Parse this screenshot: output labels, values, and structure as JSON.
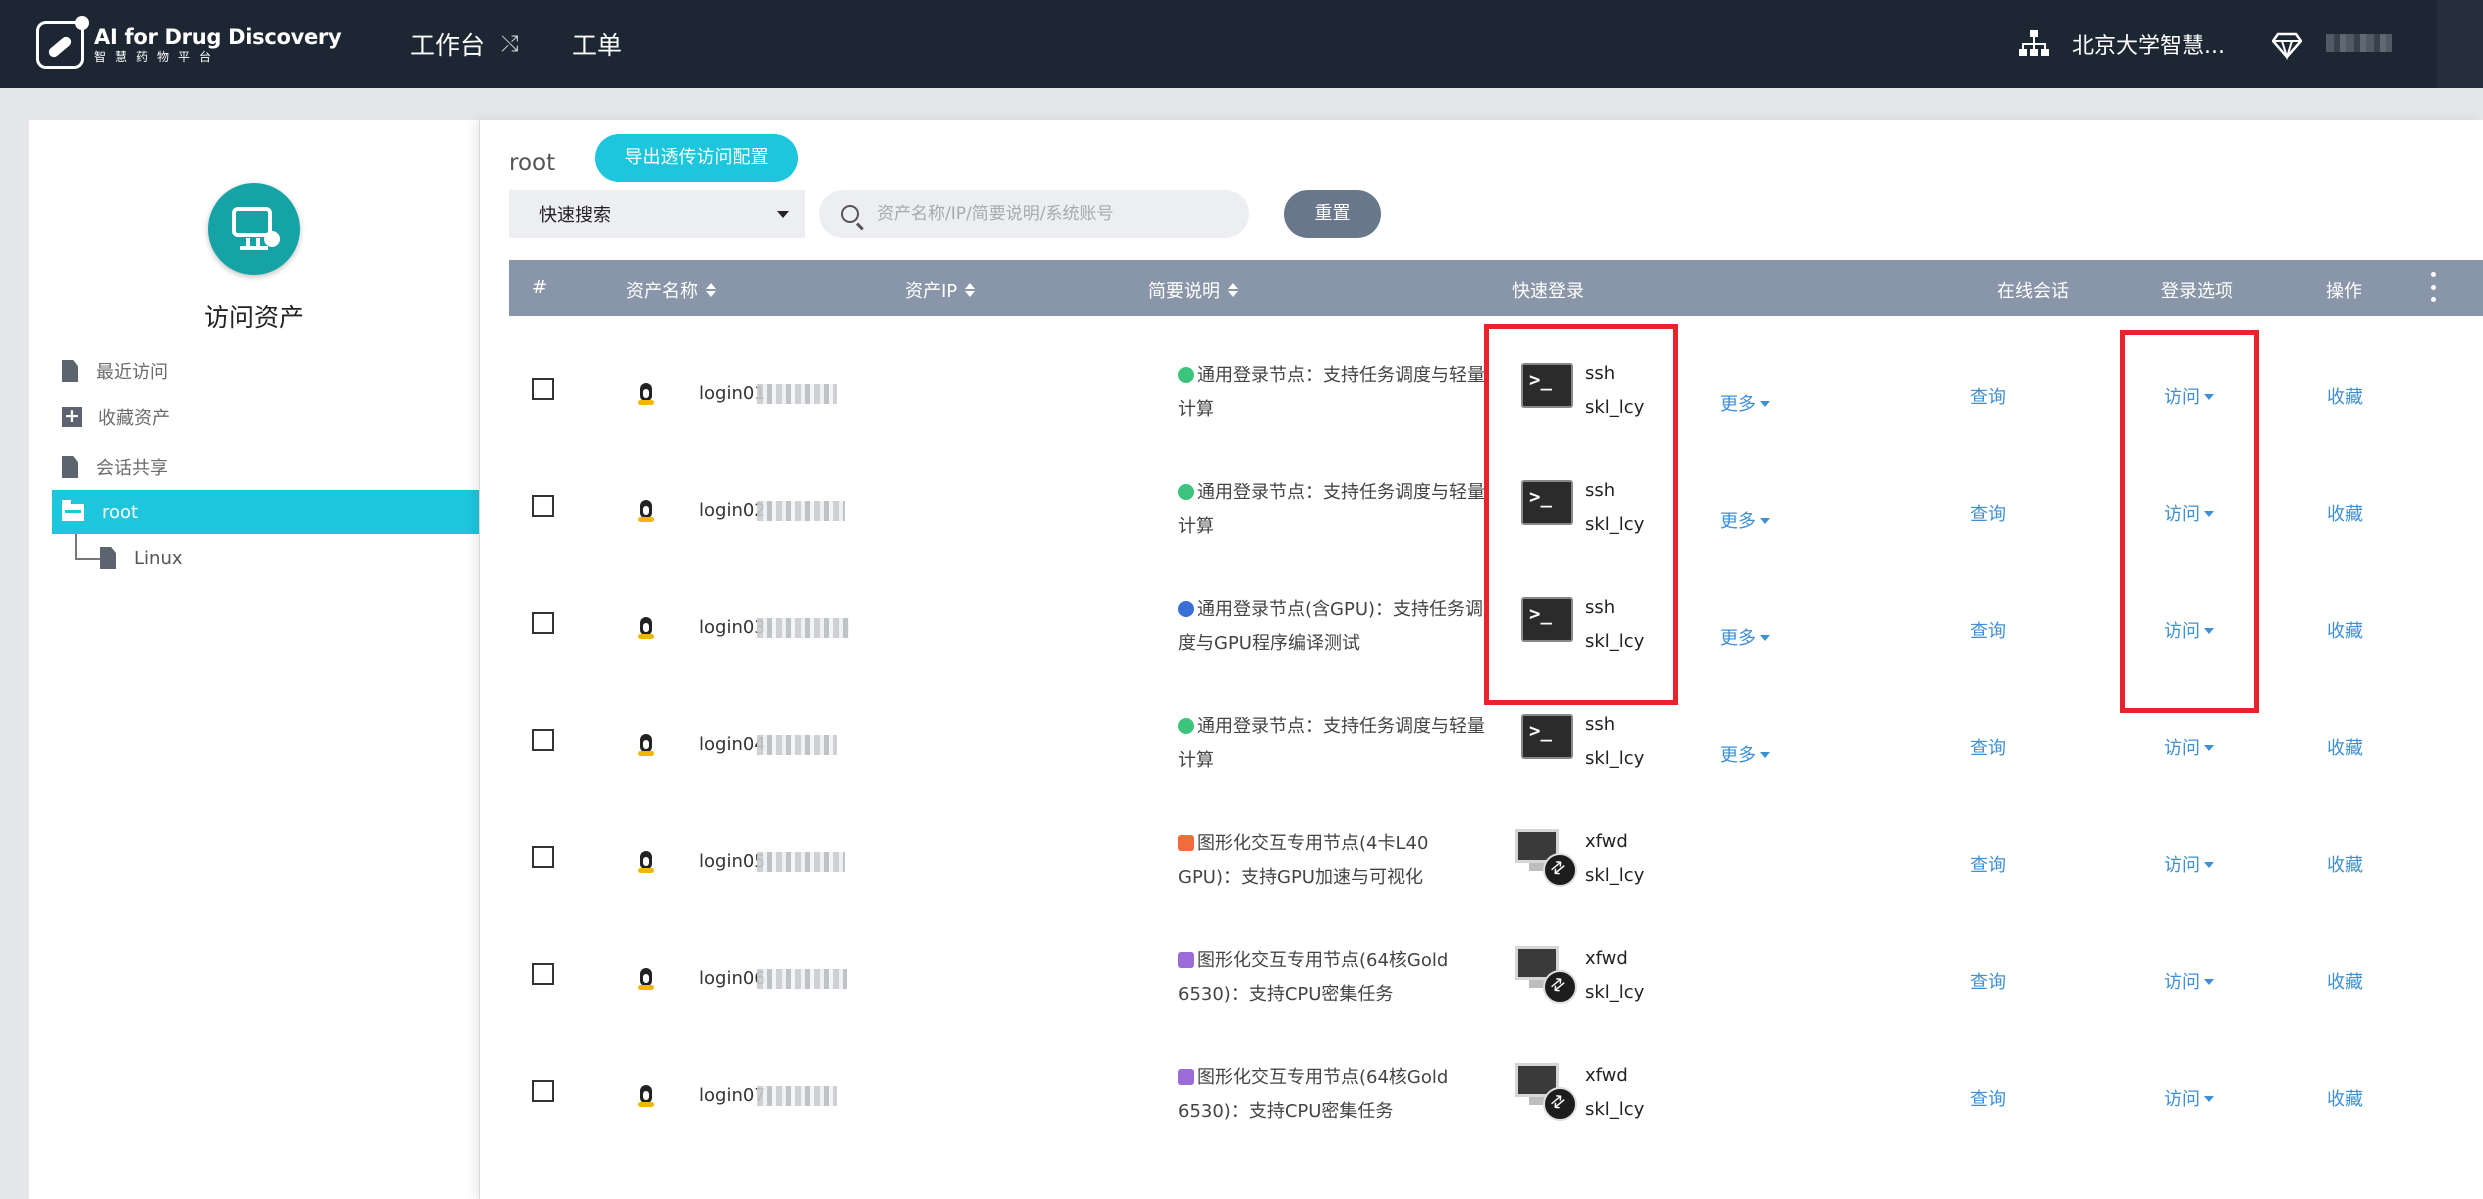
{
  "brand": {
    "title": "AI for Drug Discovery",
    "subtitle": "智慧药物平台"
  },
  "topnav": {
    "workbench": "工作台",
    "workorder": "工单",
    "org": "北京大学智慧..."
  },
  "sidebar": {
    "title": "访问资产",
    "items": [
      {
        "label": "最近访问",
        "icon": "document-icon"
      },
      {
        "label": "收藏资产",
        "icon": "plus-square-icon"
      },
      {
        "label": "会话共享",
        "icon": "document-icon"
      }
    ],
    "tree": {
      "root": "root",
      "child": "Linux"
    }
  },
  "toolbar": {
    "breadcrumb": "root",
    "export_label": "导出透传访问配置",
    "quick_search": "快速搜索",
    "search_placeholder": "资产名称/IP/简要说明/系统账号",
    "reset_label": "重置"
  },
  "table": {
    "headers": [
      "#",
      "资产名称",
      "资产IP",
      "简要说明",
      "快速登录",
      "在线会话",
      "登录选项",
      "操作"
    ],
    "more_label": "更多",
    "session_label": "查询",
    "login_label": "访问",
    "action_label": "收藏",
    "rows": [
      {
        "name": "login01",
        "desc": "通用登录节点：支持任务调度与轻量计算",
        "marker": "green-dot",
        "protocol": "ssh",
        "account": "skl_lcy",
        "icon": "terminal-icon",
        "has_more": true
      },
      {
        "name": "login02",
        "desc": "通用登录节点：支持任务调度与轻量计算",
        "marker": "green-dot",
        "protocol": "ssh",
        "account": "skl_lcy",
        "icon": "terminal-icon",
        "has_more": true
      },
      {
        "name": "login03",
        "desc": "通用登录节点(含GPU)：支持任务调度与GPU程序编译测试",
        "marker": "blue-dot",
        "protocol": "ssh",
        "account": "skl_lcy",
        "icon": "terminal-icon",
        "has_more": true
      },
      {
        "name": "login04",
        "desc": "通用登录节点：支持任务调度与轻量计算",
        "marker": "green-dot",
        "protocol": "ssh",
        "account": "skl_lcy",
        "icon": "terminal-icon",
        "has_more": true
      },
      {
        "name": "login05",
        "desc": "图形化交互专用节点(4卡L40 GPU)：支持GPU加速与可视化",
        "marker": "orange-square",
        "protocol": "xfwd",
        "account": "skl_lcy",
        "icon": "remote-desktop-icon",
        "has_more": false
      },
      {
        "name": "login06",
        "desc": "图形化交互专用节点(64核Gold 6530)：支持CPU密集任务",
        "marker": "purple-square",
        "protocol": "xfwd",
        "account": "skl_lcy",
        "icon": "remote-desktop-icon",
        "has_more": false
      },
      {
        "name": "login07",
        "desc": "图形化交互专用节点(64核Gold 6530)：支持CPU密集任务",
        "marker": "purple-square",
        "protocol": "xfwd",
        "account": "skl_lcy",
        "icon": "remote-desktop-icon",
        "has_more": false
      }
    ]
  },
  "colors": {
    "navbar": "#1d2733",
    "accent": "#1ec6dd",
    "table_header": "#8995a8",
    "link": "#3d8fd6",
    "highlight": "#e8232b",
    "green-dot": "#3cc47c",
    "blue-dot": "#3a6fd8",
    "orange-square": "#f26b3a",
    "purple-square": "#9b6bd8"
  }
}
